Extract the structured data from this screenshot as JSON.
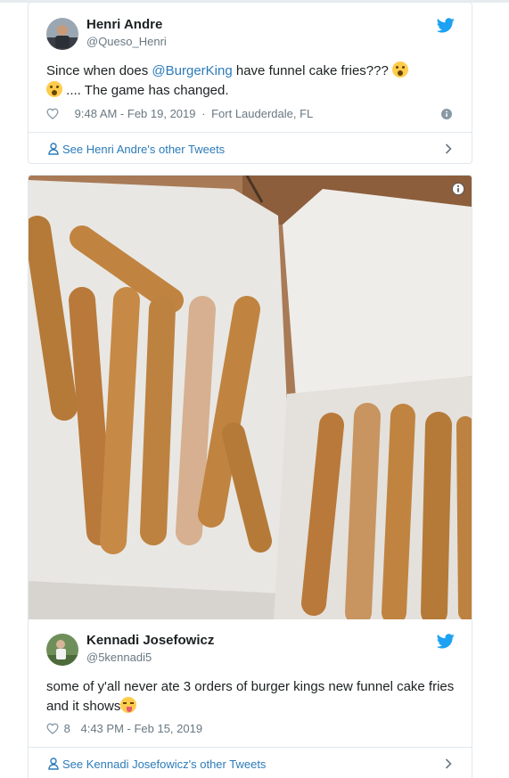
{
  "tweet1": {
    "name": "Henri Andre",
    "handle": "@Queso_Henri",
    "text_before": "Since when does ",
    "mention": "@BurgerKing",
    "text_after": " have funnel cake fries??? ",
    "text_line2": " .... The game has changed.",
    "time": "9:48 AM - Feb 19, 2019",
    "separator": "·",
    "location": "Fort Lauderdale, FL",
    "see_more": "See Henri Andre's other Tweets"
  },
  "tweet2": {
    "name": "Kennadi Josefowicz",
    "handle": "@5kennadi5",
    "text": "some of y'all never ate 3 orders of burger kings new funnel cake fries and it shows",
    "likes": "8",
    "time": "4:43 PM - Feb 15, 2019",
    "see_more": "See Kennadi Josefowicz's other Tweets"
  },
  "colors": {
    "link": "#2b7bb9",
    "twitter_blue": "#1da1f2",
    "meta": "#697882"
  },
  "icons": [
    "twitter-bird-icon",
    "heart-icon",
    "info-icon",
    "user-icon",
    "chevron-right-icon",
    "scream-emoji",
    "yum-emoji"
  ]
}
